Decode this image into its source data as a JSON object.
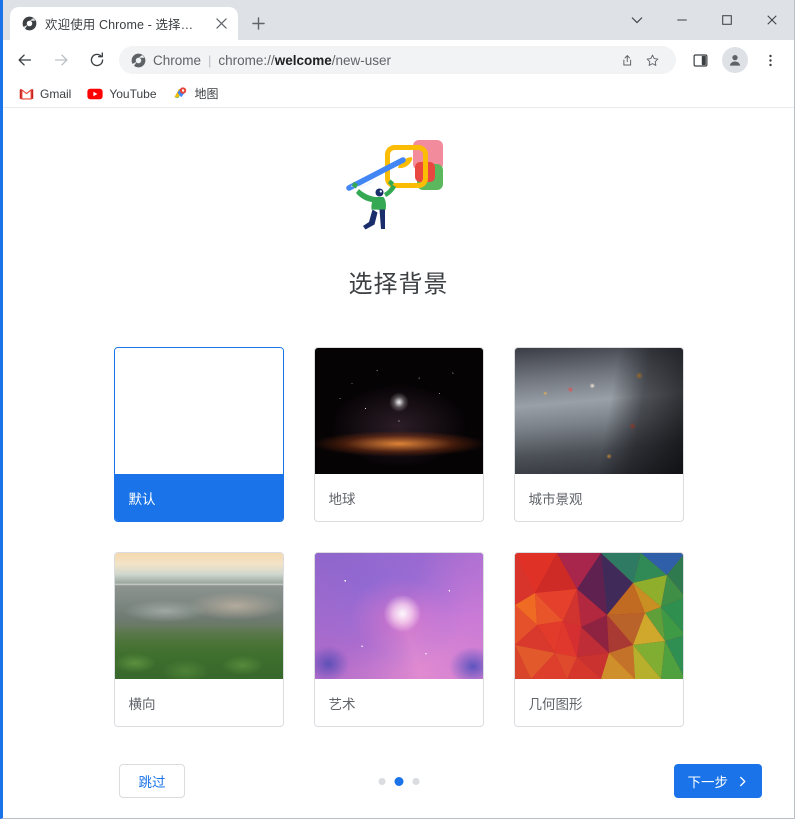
{
  "window": {
    "controls": [
      {
        "name": "tab-search",
        "glyph": "chevron-down"
      },
      {
        "name": "minimize",
        "glyph": "minimize"
      },
      {
        "name": "maximize",
        "glyph": "maximize"
      },
      {
        "name": "close",
        "glyph": "close"
      }
    ]
  },
  "tab": {
    "title": "欢迎使用 Chrome - 选择背景",
    "favicon": "chrome-globe-icon",
    "close_icon": "close-icon",
    "newtab_icon": "plus-icon"
  },
  "toolbar": {
    "back_icon": "arrow-left-icon",
    "forward_icon": "arrow-right-icon",
    "reload_icon": "reload-icon",
    "omnibox": {
      "chip_label": "Chrome",
      "separator": "|",
      "url_prefix": "chrome://",
      "url_bold": "welcome",
      "url_suffix": "/new-user",
      "share_icon": "share-icon",
      "bookmark_icon": "star-icon"
    },
    "side_panel_icon": "side-panel-icon",
    "avatar_icon": "profile-avatar-icon",
    "menu_icon": "three-dot-menu-icon"
  },
  "bookmarks": [
    {
      "label": "Gmail",
      "icon": "gmail-icon"
    },
    {
      "label": "YouTube",
      "icon": "youtube-icon"
    },
    {
      "label": "地图",
      "icon": "google-maps-icon"
    }
  ],
  "main": {
    "illustration": "person-painting-illustration",
    "title": "选择背景",
    "themes": [
      {
        "label": "默认",
        "thumb": "thumb-default",
        "selected": true
      },
      {
        "label": "地球",
        "thumb": "thumb-earth",
        "selected": false
      },
      {
        "label": "城市景观",
        "thumb": "thumb-city",
        "selected": false
      },
      {
        "label": "横向",
        "thumb": "thumb-landscape",
        "selected": false
      },
      {
        "label": "艺术",
        "thumb": "thumb-art",
        "selected": false
      },
      {
        "label": "几何图形",
        "thumb": "thumb-geo",
        "selected": false
      }
    ]
  },
  "footer": {
    "skip_label": "跳过",
    "next_label": "下一步",
    "next_arrow": "chevron-right-icon",
    "steps": {
      "total": 3,
      "active_index": 1
    }
  },
  "colors": {
    "accent": "#1a73e8",
    "tabstrip_bg": "#dee1e6",
    "omnibox_bg": "#f1f3f4",
    "text_primary": "#202124",
    "text_secondary": "#5f6368",
    "card_border": "#dadce0"
  }
}
